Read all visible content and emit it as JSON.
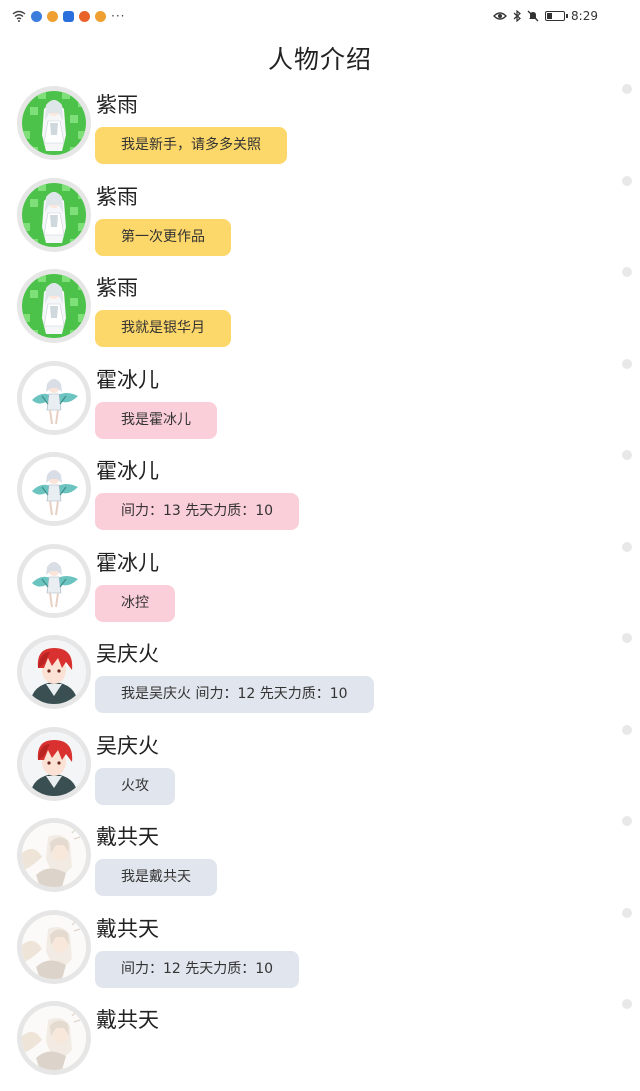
{
  "status_bar": {
    "time": "8:29",
    "overflow": "···",
    "left_icons": [
      "wifi-icon",
      "browser-icon",
      "weibo-icon",
      "shield-icon",
      "weibo-icon",
      "weibo-icon"
    ],
    "right_icons": [
      "eye-icon",
      "bluetooth-icon",
      "mute-icon",
      "battery-icon"
    ],
    "battery_level": 0.3
  },
  "page": {
    "title": "人物介绍"
  },
  "colors": {
    "yellow_bubble": "#fcd769",
    "pink_bubble": "#fbcfd9",
    "gray_bubble": "#e1e6ee",
    "avatar_ring": "#e6e6e6"
  },
  "characters": [
    {
      "name": "紫雨",
      "text": "我是新手，请多多关照",
      "bubble": "yellow",
      "avatar": "avatar-ziyu"
    },
    {
      "name": "紫雨",
      "text": "第一次更作品",
      "bubble": "yellow",
      "avatar": "avatar-ziyu"
    },
    {
      "name": "紫雨",
      "text": "我就是银华月",
      "bubble": "yellow",
      "avatar": "avatar-ziyu"
    },
    {
      "name": "霍冰儿",
      "text": "我是霍冰儿",
      "bubble": "pink",
      "avatar": "avatar-huobinger"
    },
    {
      "name": "霍冰儿",
      "text": "间力：13 先天力质：10",
      "bubble": "pink",
      "avatar": "avatar-huobinger"
    },
    {
      "name": "霍冰儿",
      "text": "冰控",
      "bubble": "pink",
      "avatar": "avatar-huobinger"
    },
    {
      "name": "吴庆火",
      "text": "我是吴庆火 间力：12 先天力质：10",
      "bubble": "gray",
      "avatar": "avatar-wuqinghuo"
    },
    {
      "name": "吴庆火",
      "text": "火攻",
      "bubble": "gray",
      "avatar": "avatar-wuqinghuo"
    },
    {
      "name": "戴共天",
      "text": "我是戴共天",
      "bubble": "gray",
      "avatar": "avatar-daigongtian"
    },
    {
      "name": "戴共天",
      "text": "间力：12 先天力质：10",
      "bubble": "gray",
      "avatar": "avatar-daigongtian"
    },
    {
      "name": "戴共天",
      "text": "",
      "bubble": "gray",
      "avatar": "avatar-daigongtian"
    }
  ]
}
